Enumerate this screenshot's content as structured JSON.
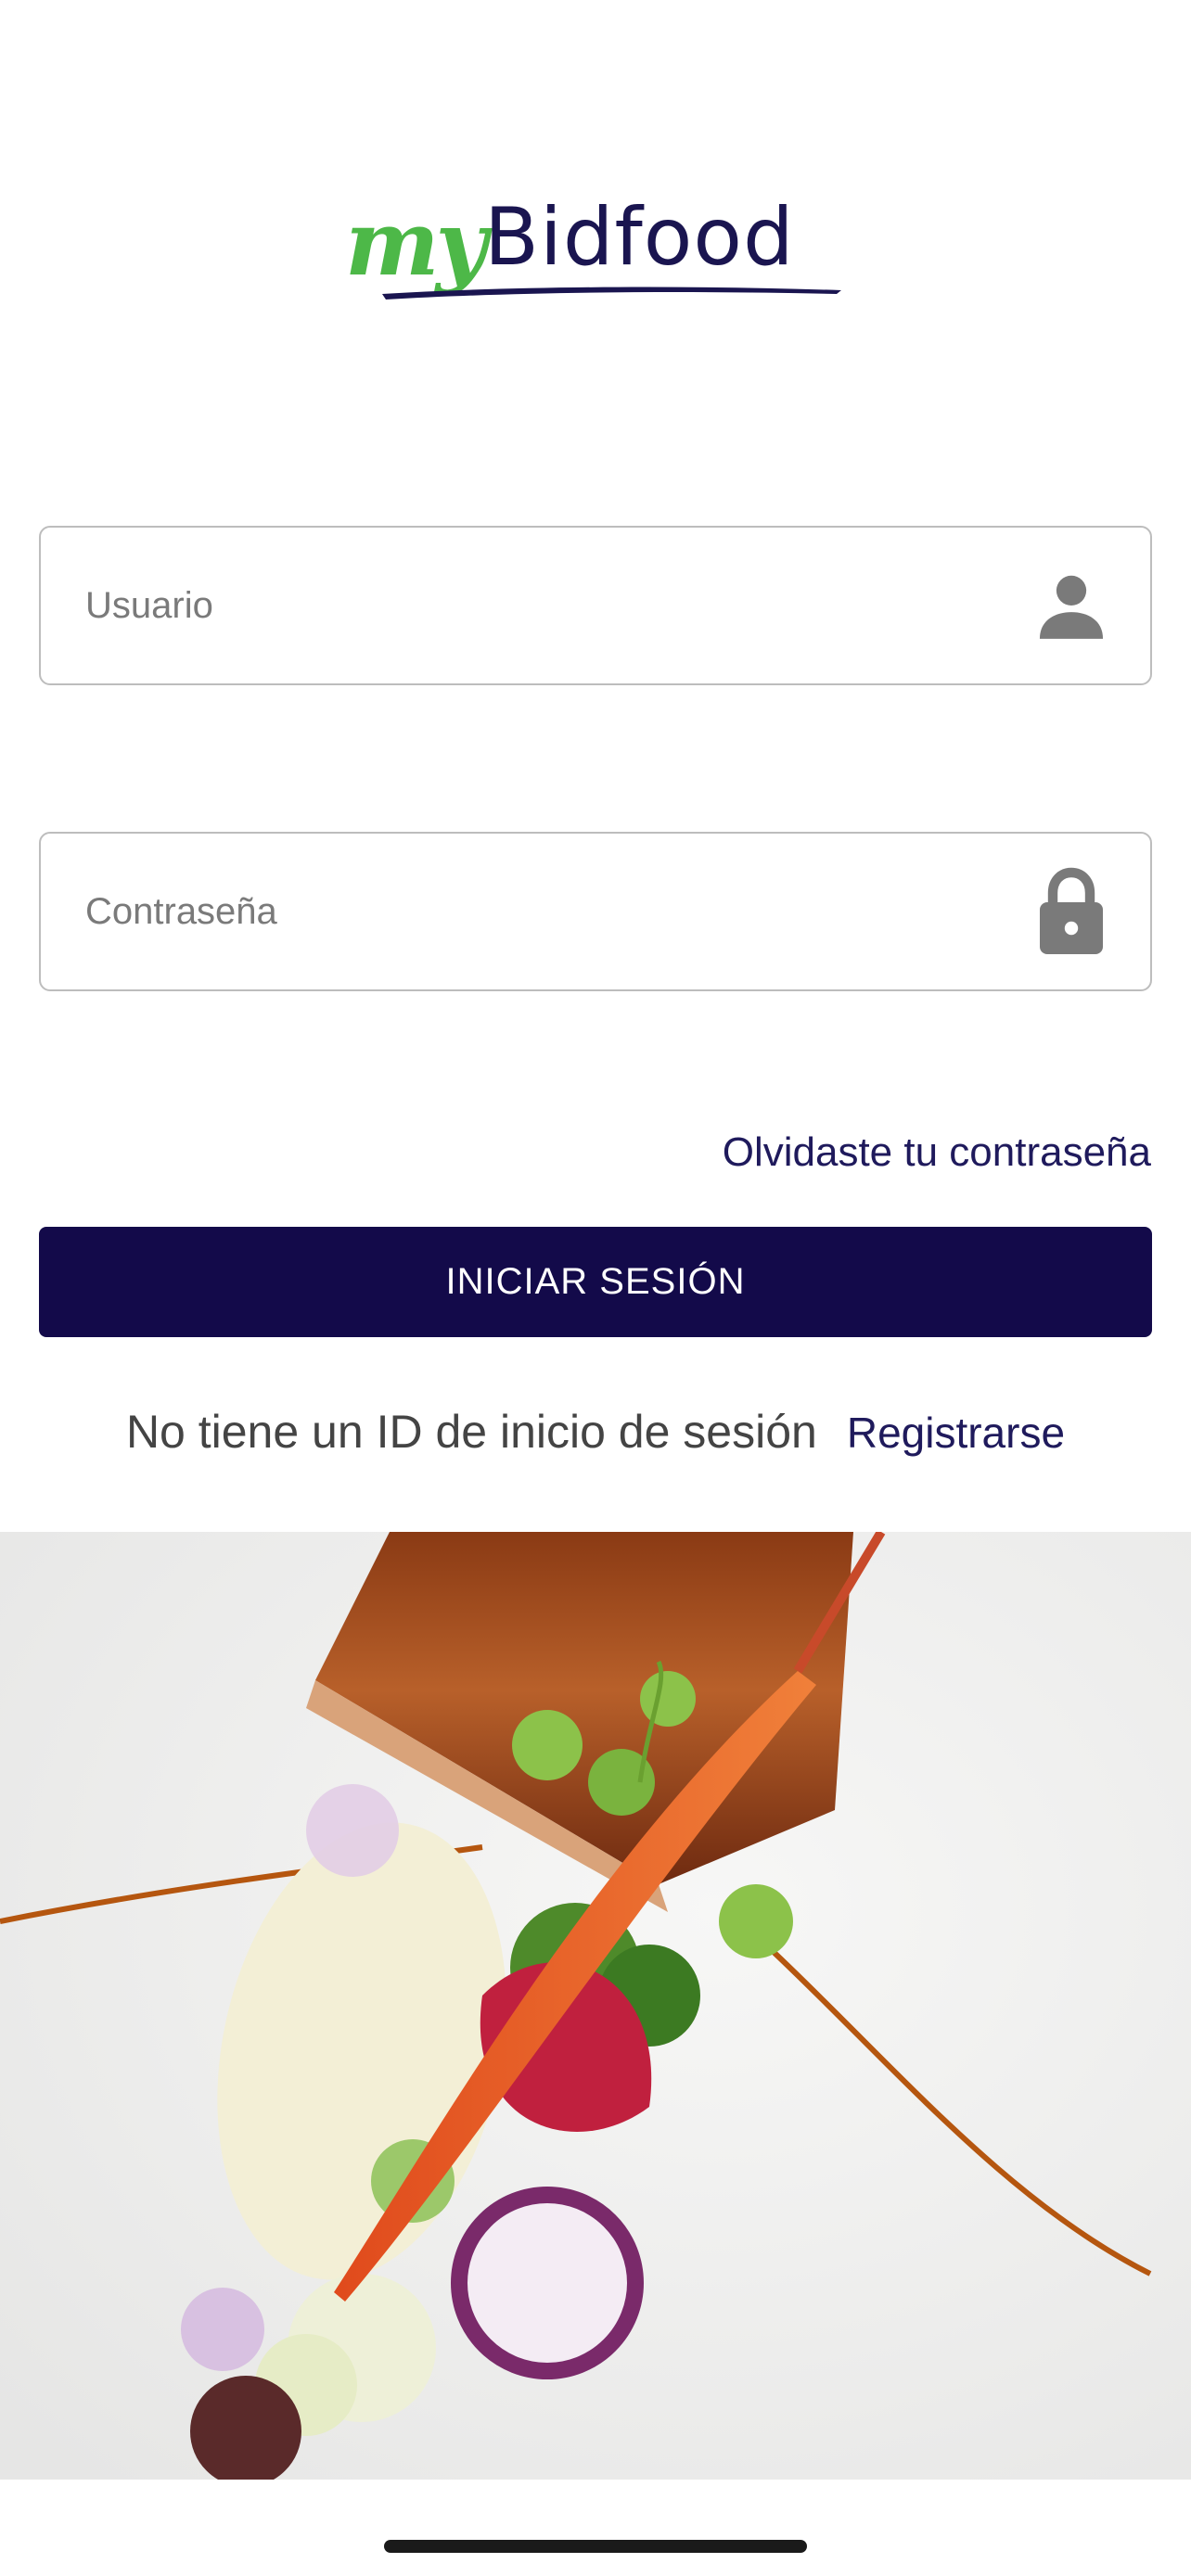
{
  "logo": {
    "prefix": "my",
    "brand": "Bidfood",
    "prefix_color": "#4db848",
    "brand_color": "#1a1550"
  },
  "form": {
    "username": {
      "placeholder": "Usuario",
      "value": "",
      "icon": "person-icon"
    },
    "password": {
      "placeholder": "Contraseña",
      "value": "",
      "icon": "lock-icon"
    },
    "forgot_label": "Olvidaste tu contraseña",
    "login_label": "INICIAR SESIÓN",
    "login_color": "#130a4a"
  },
  "register": {
    "prompt": "No tiene un ID de inicio de sesión",
    "link_label": "Registrarse"
  },
  "colors": {
    "accent": "#1f1a5c",
    "border": "#bdbdbd",
    "icon": "#7a7a7a"
  }
}
